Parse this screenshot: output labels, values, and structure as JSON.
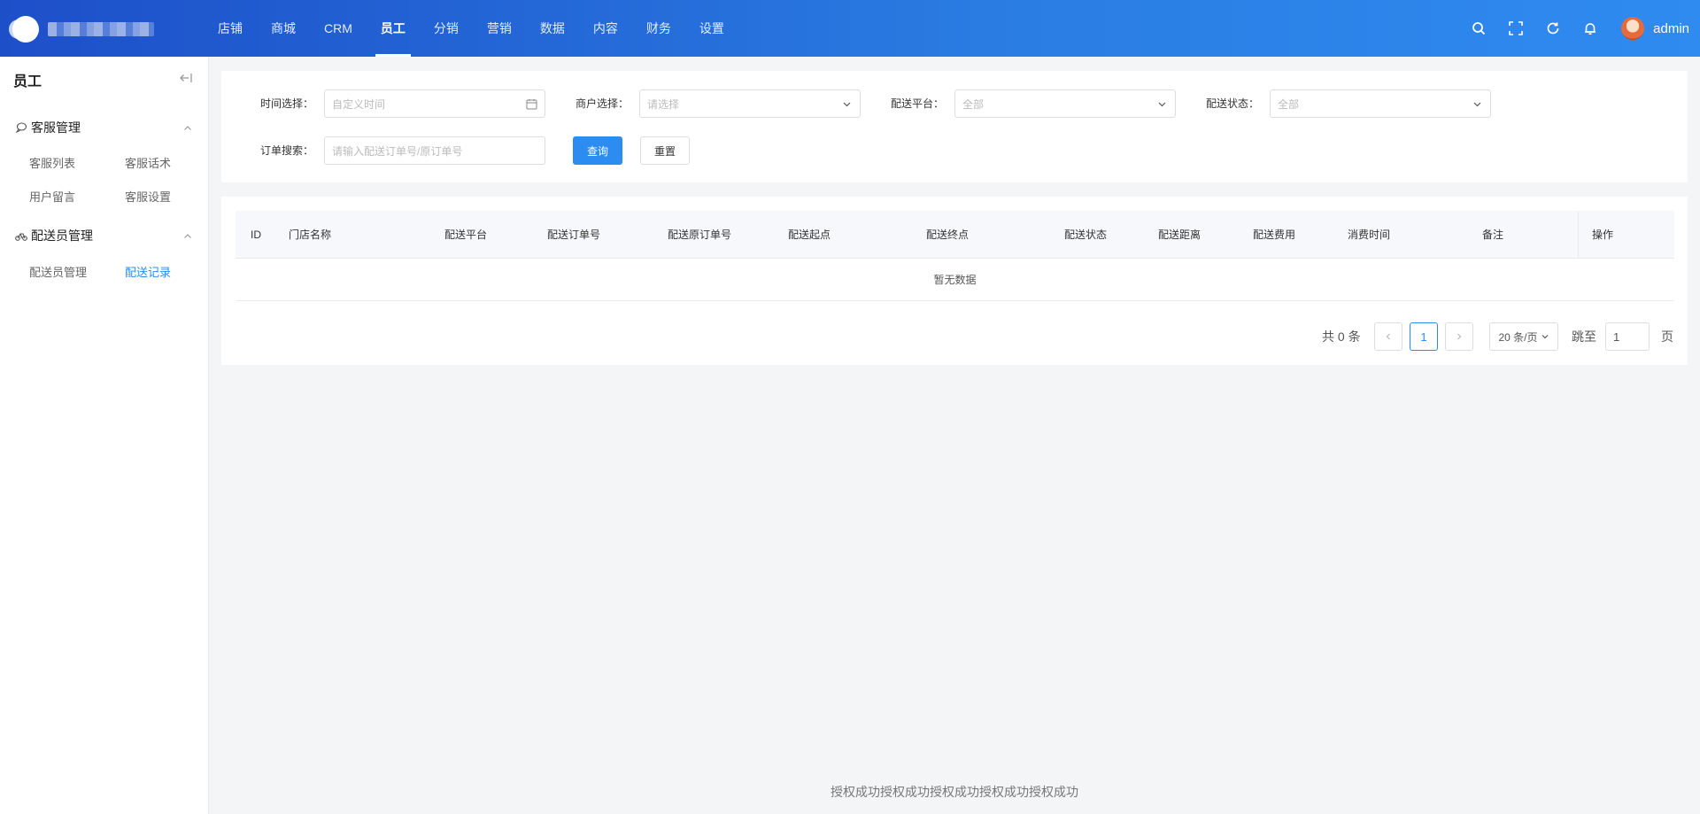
{
  "header": {
    "nav": [
      "店铺",
      "商城",
      "CRM",
      "员工",
      "分销",
      "营销",
      "数据",
      "内容",
      "财务",
      "设置"
    ],
    "active_nav": "员工",
    "username": "admin"
  },
  "sidebar": {
    "title": "员工",
    "groups": [
      {
        "label": "客服管理",
        "items": [
          "客服列表",
          "客服话术",
          "用户留言",
          "客服设置"
        ]
      },
      {
        "label": "配送员管理",
        "items": [
          "配送员管理",
          "配送记录"
        ]
      }
    ],
    "active_item": "配送记录"
  },
  "filters": {
    "time_label": "时间选择：",
    "time_placeholder": "自定义时间",
    "merchant_label": "商户选择：",
    "merchant_placeholder": "请选择",
    "platform_label": "配送平台：",
    "platform_value": "全部",
    "status_label": "配送状态：",
    "status_value": "全部",
    "order_label": "订单搜索：",
    "order_placeholder": "请输入配送订单号/原订单号",
    "query_button": "查询",
    "reset_button": "重置"
  },
  "table": {
    "columns": [
      "ID",
      "门店名称",
      "配送平台",
      "配送订单号",
      "配送原订单号",
      "配送起点",
      "配送终点",
      "配送状态",
      "配送距离",
      "配送费用",
      "消费时间",
      "备注",
      "操作"
    ],
    "empty_text": "暂无数据"
  },
  "pagination": {
    "total_text": "共 0 条",
    "current_page": "1",
    "page_size": "20 条/页",
    "jump_label": "跳至",
    "jump_value": "1",
    "page_suffix": "页"
  },
  "footer": "授权成功授权成功授权成功授权成功授权成功"
}
